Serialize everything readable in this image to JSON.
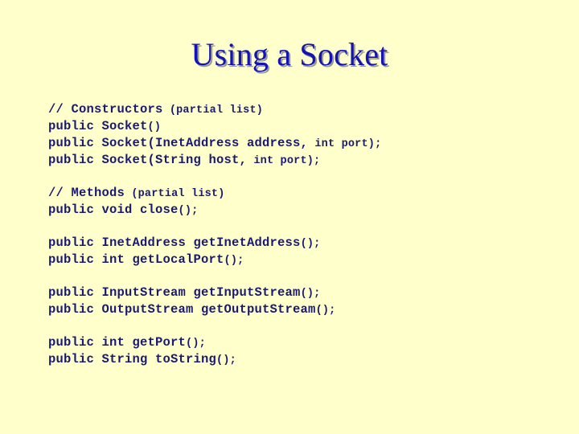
{
  "slide": {
    "title": "Using a Socket",
    "background_color": "#ffffcc",
    "title_color": "#1414b4",
    "title_shadow_color": "#9a9a9a",
    "code_color": "#1a1a70"
  },
  "code": {
    "blocks": [
      {
        "name": "constructors-block",
        "lines": [
          {
            "large": "// Constructors",
            "small": " (partial list)"
          },
          {
            "large": "public Socket",
            "small": "()"
          },
          {
            "large": "public Socket(InetAddress address,",
            "small": " int port);"
          },
          {
            "large": "public Socket(String host,",
            "small": " int port);"
          }
        ]
      },
      {
        "name": "methods-block",
        "lines": [
          {
            "large": "// Methods",
            "small": " (partial list)"
          },
          {
            "large": "public void close",
            "small": "();"
          }
        ]
      },
      {
        "name": "address-accessors-block",
        "lines": [
          {
            "large": "public InetAddress getInetAddress",
            "small": "();"
          },
          {
            "large": "public int getLocalPort",
            "small": "();"
          }
        ]
      },
      {
        "name": "stream-accessors-block",
        "lines": [
          {
            "large": "public InputStream getInputStream",
            "small": "();"
          },
          {
            "large": "public OutputStream getOutputStream",
            "small": "();"
          }
        ]
      },
      {
        "name": "misc-accessors-block",
        "lines": [
          {
            "large": "public int getPort",
            "small": "();"
          },
          {
            "large": "public String toString",
            "small": "();"
          }
        ]
      }
    ]
  }
}
